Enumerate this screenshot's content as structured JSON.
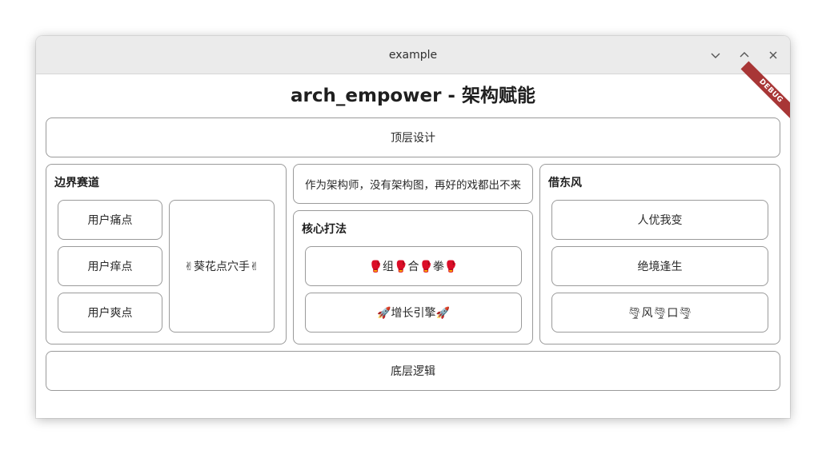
{
  "window": {
    "title": "example"
  },
  "app": {
    "title": "arch_empower - 架构赋能",
    "debug_banner": "DEBUG"
  },
  "top_layer": {
    "label": "顶层设计"
  },
  "boundary": {
    "title": "边界赛道",
    "pain": "用户痛点",
    "itch": "用户痒点",
    "delight": "用户爽点",
    "sunflower": "✌葵花点穴手✌"
  },
  "center": {
    "motto": "作为架构师，没有架构图，再好的戏都出不来",
    "core_title": "核心打法",
    "combo_punch": "🥊组🥊合🥊拳🥊",
    "growth_engine": "🚀增长引擎🚀"
  },
  "borrow_wind": {
    "title": "借东风",
    "differentiate": "人优我变",
    "turnaround": "绝境逢生",
    "wind_gap": "🌪风🌪口🌪"
  },
  "bottom_layer": {
    "label": "底层逻辑"
  },
  "colors": {
    "titlebar": "#ebebeb",
    "border": "#9a9a9a",
    "debug_ribbon": "#a83636"
  }
}
